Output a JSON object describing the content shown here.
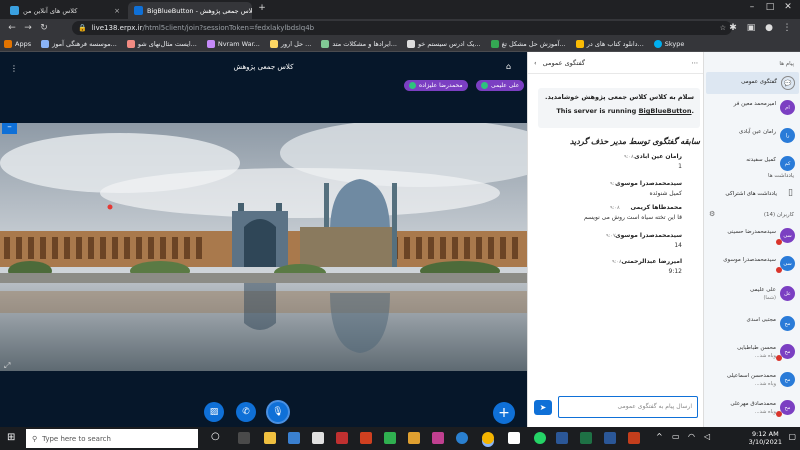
{
  "browser": {
    "tabs": [
      {
        "title": "کلاس های آنلاین من",
        "close": "×"
      },
      {
        "title": "BigBlueButton - کلاس جمعی پژوهش",
        "close": "×"
      }
    ],
    "new_tab": "+",
    "url_host": "live138.erpx.ir",
    "url_path": "/html5client/join?sessionToken=fedxlakylbdslq4b",
    "bookmarks": [
      "Apps",
      "موسسه فرهنگی آموز...",
      "ایست مثال‌نهای شو...",
      "Nvram War...",
      "حل ارور ...",
      "ایرادها و مشکلات متد...",
      "یک ادرس سیستم خو...",
      "آموزش حل مشکل تغ...",
      "دانلود کتاب های در...",
      "Skype"
    ]
  },
  "main": {
    "room_title": "کلاس جمعی پژوهش",
    "presenters": [
      "علی علیمی",
      "محمدرضا علیزاده"
    ]
  },
  "chat": {
    "title": "گفتگوی عمومی",
    "welcome_fa": "سلام به کلاس کلاس جمعی پژوهش خوشامدید.",
    "welcome_en_prefix": "This server is running ",
    "welcome_en_link": "BigBlueButton",
    "welcome_en_suffix": ".",
    "cleared_notice": "سابقه گفتگوی توسط مدیر حذف گردید",
    "messages": [
      {
        "initials": "را",
        "name": "رامان عین ابادی",
        "time": "۹:۰۸",
        "text": "1",
        "color": "#2a7bd8"
      },
      {
        "initials": "سی",
        "name": "سیدمحمدصدرا موسوی",
        "time": "۹:۰۸",
        "text": "کمیل شنوئده",
        "color": "#7b3fc2"
      },
      {
        "initials": "مح",
        "name": "محمدطاها کریمی",
        "time": "۹:۰۸",
        "text": "قا این تخته سیاه است روش می نویسم",
        "color": "#7b3fc2"
      },
      {
        "initials": "سی",
        "name": "سیدمحمدصدرا موسوی",
        "time": "۹:۰۷",
        "text": "14",
        "color": "#7b3fc2"
      },
      {
        "initials": "ام",
        "name": "امیررضا عبدالرحمتی",
        "time": "۹:۰۸",
        "text": "9:12",
        "color": "#2a7bd8"
      }
    ],
    "input_placeholder": "ارسال پیام به گفتگوی عمومی"
  },
  "users": {
    "messages_header": "پیام ها",
    "public_chat": "گفتگوی عمومی",
    "notes_header": "یادداشت ها",
    "shared_notes": "یادداشت های اشتراکی",
    "users_header": "کاربران (14)",
    "list": [
      {
        "initials": "ام",
        "name": "امیرمحمد معین فر",
        "status": "",
        "color": "#7b3fc2"
      },
      {
        "initials": "را",
        "name": "رامان عین آبادی",
        "status": "",
        "color": "#2a7bd8"
      },
      {
        "initials": "کم",
        "name": "کمیل سفیدنه",
        "status": "",
        "color": "#2a7bd8"
      },
      {
        "initials": "سی",
        "name": "سیدمحمدرضا حسینی",
        "status": "",
        "color": "#7b3fc2"
      },
      {
        "initials": "سی",
        "name": "سیدمحمدصدرا موسوی",
        "status": "",
        "color": "#2a7bd8"
      },
      {
        "initials": "عل",
        "name": "علی علیمی",
        "status": "(شما)",
        "color": "#7b3fc2"
      },
      {
        "initials": "مج",
        "name": "مجتبی اسدی",
        "status": "",
        "color": "#2a7bd8"
      },
      {
        "initials": "مح",
        "name": "محسن طباطبایی",
        "status": "ویاه شد...",
        "color": "#7b3fc2"
      },
      {
        "initials": "مح",
        "name": "محمدحسن اسماعیلی",
        "status": "ویاه شد...",
        "color": "#2a7bd8"
      },
      {
        "initials": "مح",
        "name": "محمدصادق مهرعلی",
        "status": "ویاه شد...",
        "color": "#7b3fc2"
      }
    ]
  },
  "taskbar": {
    "search_placeholder": "Type here to search",
    "time": "9:12 AM",
    "date": "3/10/2021"
  },
  "colors": {
    "accent": "#0f70d7",
    "purple": "#7b3fc2",
    "background_dark": "#06172a"
  }
}
